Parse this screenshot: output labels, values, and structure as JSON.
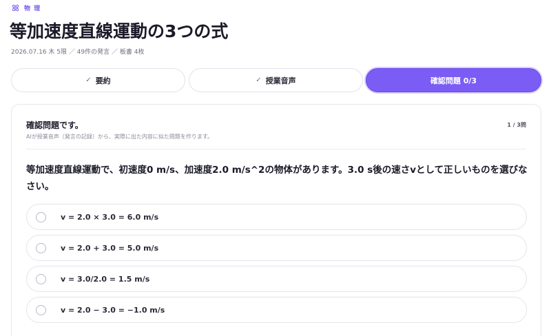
{
  "subject": {
    "label": "物 理",
    "icon": "atom-icon"
  },
  "title": "等加速度直線運動の3つの式",
  "meta": "2026.07.16 木 5限 ／ 49件の発言 ／ 板書 4枚",
  "tabs": [
    {
      "label": "要約",
      "check": "✓",
      "active": false
    },
    {
      "label": "授業音声",
      "check": "✓",
      "active": false
    },
    {
      "label": "確認問題 0/3",
      "active": true
    }
  ],
  "quiz": {
    "heading": "確認問題です。",
    "description": "AIが授業音声（発言の記録）から、実際に出た内容に似た問題を作ります。",
    "counter": "1 / 3問",
    "question": "等加速度直線運動で、初速度0 m/s、加速度2.0 m/s^2の物体があります。3.0 s後の速さvとして正しいものを選びなさい。",
    "options": [
      {
        "label": "v = 2.0 × 3.0 = 6.0 m/s"
      },
      {
        "label": "v = 2.0 + 3.0 = 5.0 m/s"
      },
      {
        "label": "v = 3.0/2.0 = 1.5 m/s"
      },
      {
        "label": "v = 2.0 − 3.0 = −1.0 m/s"
      }
    ]
  },
  "colors": {
    "accent": "#7b5cf5",
    "accent_light": "#d8cffc",
    "border": "#e4e4ec"
  }
}
